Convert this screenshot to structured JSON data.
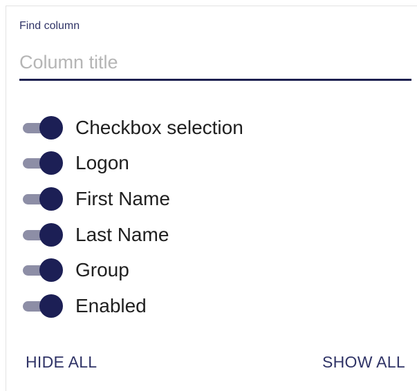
{
  "find_column": {
    "label": "Find column",
    "placeholder": "Column title",
    "value": ""
  },
  "columns": [
    {
      "label": "Checkbox selection",
      "enabled": true
    },
    {
      "label": "Logon",
      "enabled": true
    },
    {
      "label": "First Name",
      "enabled": true
    },
    {
      "label": "Last Name",
      "enabled": true
    },
    {
      "label": "Group",
      "enabled": true
    },
    {
      "label": "Enabled",
      "enabled": true
    }
  ],
  "actions": {
    "hide_all": "HIDE ALL",
    "show_all": "SHOW ALL"
  },
  "colors": {
    "accent": "#1c1f55",
    "track": "#8d8ea6",
    "label": "#2f3366"
  }
}
